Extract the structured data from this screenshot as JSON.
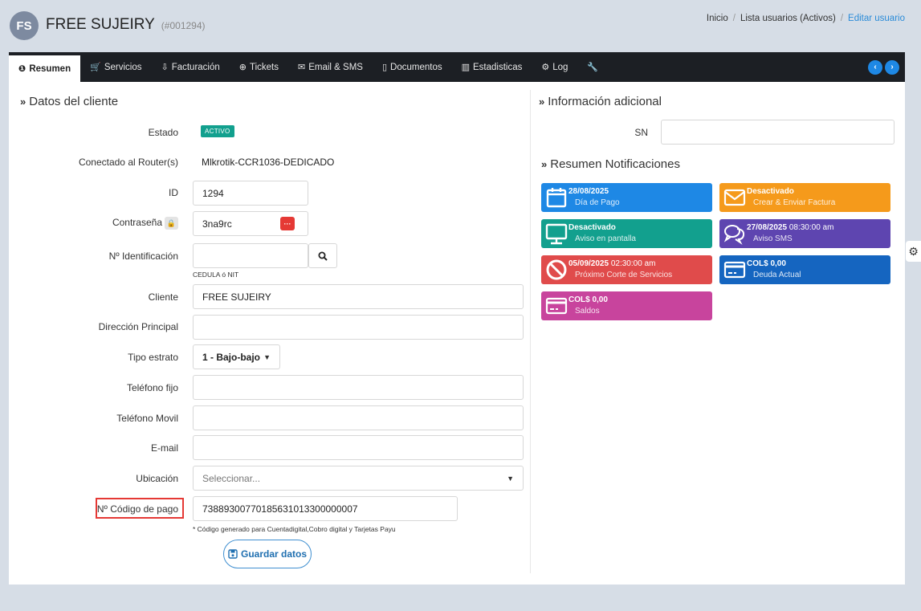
{
  "header": {
    "avatar_initials": "FS",
    "client_name": "FREE SUJEIRY",
    "client_code": "(#001294)",
    "breadcrumb": [
      "Inicio",
      "Lista usuarios (Activos)",
      "Editar usuario"
    ]
  },
  "tabs": [
    {
      "label": "Resumen",
      "icon": "info-icon",
      "glyph": "❶"
    },
    {
      "label": "Servicios",
      "icon": "cart-icon",
      "glyph": "🛒"
    },
    {
      "label": "Facturación",
      "icon": "billing-icon",
      "glyph": "⇩"
    },
    {
      "label": "Tickets",
      "icon": "globe-icon",
      "glyph": "⊕"
    },
    {
      "label": "Email & SMS",
      "icon": "envelope-icon",
      "glyph": "✉"
    },
    {
      "label": "Documentos",
      "icon": "document-icon",
      "glyph": "▯"
    },
    {
      "label": "Estadisticas",
      "icon": "chart-icon",
      "glyph": "▥"
    },
    {
      "label": "Log",
      "icon": "cogs-icon",
      "glyph": "⚙"
    },
    {
      "label": "",
      "icon": "wrench-icon",
      "glyph": "🔧"
    }
  ],
  "tab_arrows": {
    "prev": "‹",
    "next": "›"
  },
  "left": {
    "title": "Datos del cliente",
    "estado_label": "Estado",
    "estado_value": "ACTIVO",
    "router_label": "Conectado al Router(s)",
    "router_value": "Mlkrotik-CCR1036-DEDICADO",
    "id_label": "ID",
    "id_value": "1294",
    "password_label": "Contraseña",
    "password_value": "3na9rc",
    "ident_label": "Nº Identificación",
    "ident_value": "",
    "ident_note": "CEDULA ó NIT",
    "cliente_label": "Cliente",
    "cliente_value": "FREE SUJEIRY",
    "direccion_label": "Dirección Principal",
    "direccion_value": "",
    "estrato_label": "Tipo estrato",
    "estrato_value": "1 - Bajo-bajo",
    "telefono_fijo_label": "Teléfono fijo",
    "telefono_fijo_value": "",
    "telefono_movil_label": "Teléfono Movil",
    "telefono_movil_value": "",
    "email_label": "E-mail",
    "email_value": "",
    "ubicacion_label": "Ubicación",
    "ubicacion_placeholder": "Seleccionar...",
    "codigo_label": "Nº Código de pago",
    "codigo_value": "7388930077018563101330000000​7",
    "codigo_note": "* Código generado para Cuentadigital,Cobro digital y Tarjetas Payu",
    "save_label": "Guardar datos"
  },
  "right": {
    "title": "Información adicional",
    "sn_label": "SN",
    "sn_value": "",
    "notif_title": "Resumen Notificaciones",
    "cards": [
      {
        "title": "28/08/2025",
        "time": "",
        "sub": "Día de Pago",
        "color": "#1e88e5",
        "icon": "calendar-icon"
      },
      {
        "title": "Desactivado",
        "time": "",
        "sub": "Crear & Enviar Factura",
        "color": "#f59a1b",
        "icon": "envelope-icon"
      },
      {
        "title": "Desactivado",
        "time": "",
        "sub": "Aviso en pantalla",
        "color": "#12a08e",
        "icon": "monitor-icon"
      },
      {
        "title": "27/08/2025",
        "time": "08:30:00 am",
        "sub": "Aviso SMS",
        "color": "#5e45b0",
        "icon": "chat-icon"
      },
      {
        "title": "05/09/2025",
        "time": "02:30:00 am",
        "sub": "Próximo Corte de Servicios",
        "color": "#e04b4b",
        "icon": "ban-icon"
      },
      {
        "title": "COL$ 0,00",
        "time": "",
        "sub": "Deuda Actual",
        "color": "#1565c0",
        "icon": "credit-card-icon"
      },
      {
        "title": "COL$ 0,00",
        "time": "",
        "sub": "Saldos",
        "color": "#c8449d",
        "icon": "credit-card-icon"
      }
    ]
  }
}
